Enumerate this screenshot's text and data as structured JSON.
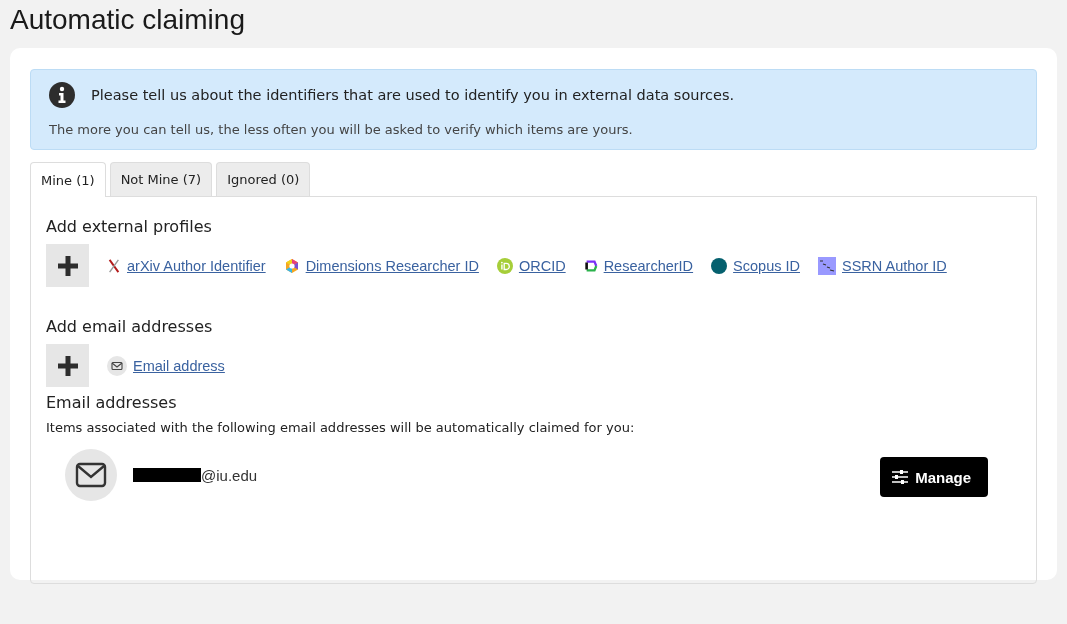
{
  "page_title": "Automatic claiming",
  "info": {
    "heading": "Please tell us about the identifiers that are used to identify you in external data sources.",
    "text": "The more you can tell us, the less often you will be asked to verify which items are yours."
  },
  "tabs": [
    {
      "label": "Mine (1)",
      "selected": true
    },
    {
      "label": "Not Mine (7)",
      "selected": false
    },
    {
      "label": "Ignored (0)",
      "selected": false
    }
  ],
  "external_profiles": {
    "heading": "Add external profiles",
    "items": [
      {
        "label": "arXiv Author Identifier",
        "kind": "arxiv"
      },
      {
        "label": "Dimensions Researcher ID",
        "kind": "dimensions"
      },
      {
        "label": "ORCID",
        "kind": "orcid"
      },
      {
        "label": "ResearcherID",
        "kind": "researcherid"
      },
      {
        "label": "Scopus ID",
        "kind": "scopus"
      },
      {
        "label": "SSRN Author ID",
        "kind": "ssrn"
      }
    ]
  },
  "add_email": {
    "heading": "Add email addresses",
    "items": [
      {
        "label": "Email address",
        "kind": "email"
      }
    ]
  },
  "email_addresses": {
    "heading": "Email addresses",
    "description": "Items associated with the following email addresses will be automatically claimed for you:",
    "items": [
      {
        "address": "@iu.edu",
        "redacted": true,
        "button": "Manage"
      }
    ]
  }
}
